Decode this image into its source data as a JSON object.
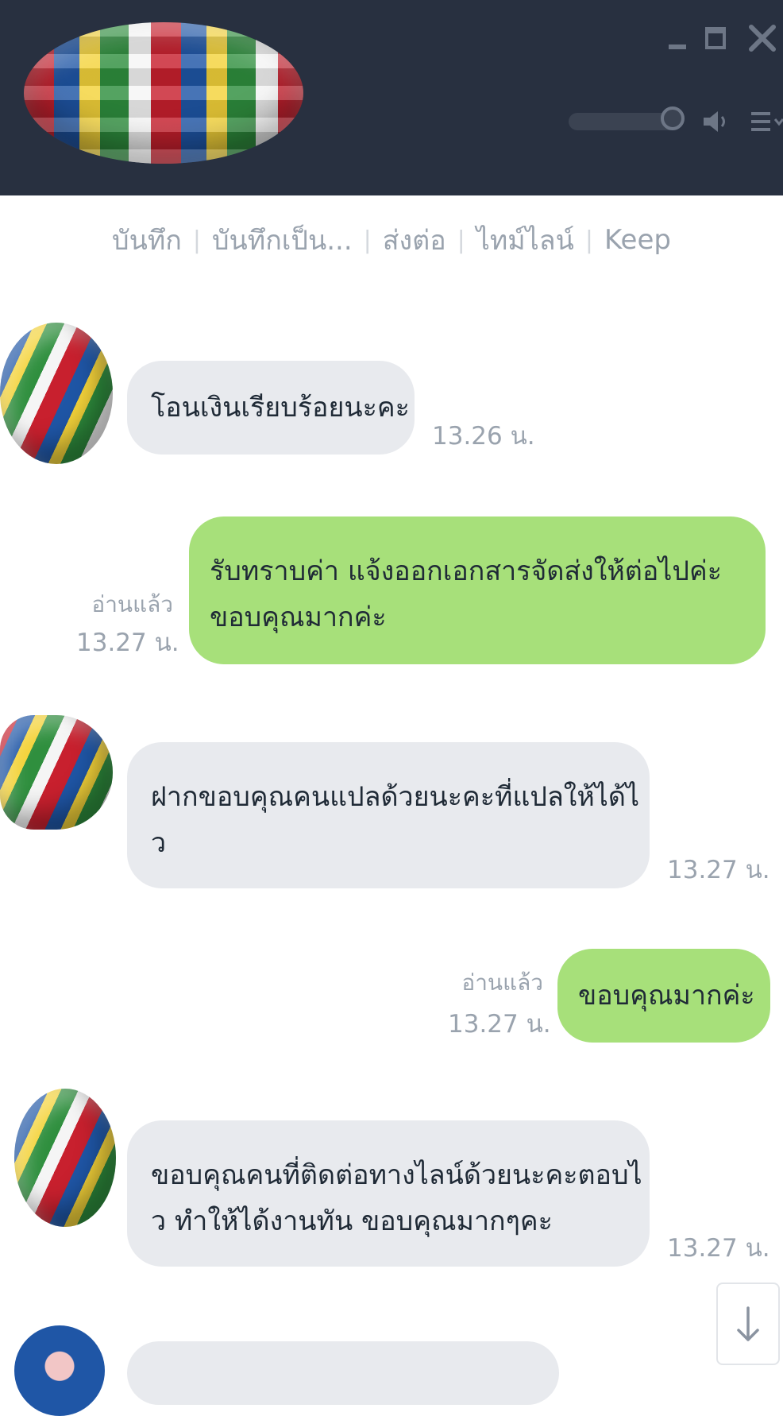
{
  "window": {
    "controls": [
      "minimize",
      "maximize",
      "close"
    ]
  },
  "header": {
    "avatar_icon": "flag-globe-icon",
    "volume": 1.0
  },
  "toolbar": {
    "items": [
      {
        "label": "บันทึก"
      },
      {
        "label": "บันทึกเป็น..."
      },
      {
        "label": "ส่งต่อ"
      },
      {
        "label": "ไทม์ไลน์"
      },
      {
        "label": "Keep"
      }
    ]
  },
  "messages": [
    {
      "side": "in",
      "lines": [
        "โอนเงินเรียบร้อยนะคะ"
      ],
      "time": "13.26 น."
    },
    {
      "side": "out",
      "lines": [
        "รับทราบค่า แจ้งออกเอกสารจัดส่งให้ต่อไปค่ะ",
        "ขอบคุณมากค่ะ"
      ],
      "read": "อ่านแล้ว",
      "time": "13.27 น."
    },
    {
      "side": "in",
      "lines": [
        "ฝากขอบคุณคนแปลด้วยนะคะที่แปลให้ได้ไ",
        "ว"
      ],
      "time": "13.27 น."
    },
    {
      "side": "out",
      "lines": [
        "ขอบคุณมากค่ะ"
      ],
      "read": "อ่านแล้ว",
      "time": "13.27 น."
    },
    {
      "side": "in",
      "lines": [
        "ขอบคุณคนที่ติดต่อทางไลน์ด้วยนะคะตอบไ",
        "ว ทำให้ได้งานทัน ขอบคุณมากๆคะ"
      ],
      "time": "13.27 น."
    }
  ],
  "colors": {
    "header_bg": "#283040",
    "incoming_bubble": "#e8eaee",
    "outgoing_bubble": "#a7e07a",
    "meta_text": "#9aa3ae"
  }
}
